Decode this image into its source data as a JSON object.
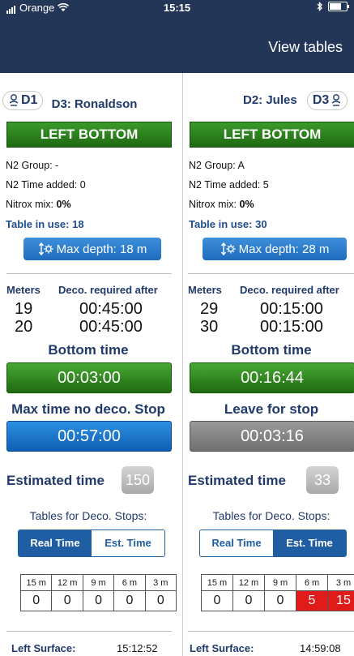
{
  "status_bar": {
    "carrier": "Orange",
    "time": "15:15"
  },
  "nav": {
    "title": "View tables"
  },
  "left": {
    "prev_label": "D1",
    "diver_name": "D3: Ronaldson",
    "state": "LEFT BOTTOM",
    "n2_group_label": "N2 Group:",
    "n2_group": "-",
    "n2_time_label": "N2 Time added:",
    "n2_time": "0",
    "nitrox_label": "Nitrox mix:",
    "nitrox": "0%",
    "table_in_use": "Table in use: 18",
    "max_depth": "Max depth: 18 m",
    "meters_header": "Meters",
    "deco_header": "Deco. required after",
    "deco_rows": [
      {
        "m": "19",
        "t": "00:45:00"
      },
      {
        "m": "20",
        "t": "00:45:00"
      }
    ],
    "bottom_time_label": "Bottom time",
    "bottom_time": "00:03:00",
    "timer2_label": "Max time no deco. Stop",
    "timer2": "00:57:00",
    "est_label": "Estimated time",
    "est_value": "150",
    "tables_label": "Tables for Deco. Stops:",
    "seg_real": "Real Time",
    "seg_est": "Est. Time",
    "stop_headers": [
      "15 m",
      "12 m",
      "9 m",
      "6 m",
      "3 m"
    ],
    "stops": [
      "0",
      "0",
      "0",
      "0",
      "0"
    ],
    "surface_label": "Left Surface:",
    "surface_time": "15:12:52"
  },
  "right": {
    "diver_name": "D2: Jules",
    "next_label": "D3",
    "state": "LEFT BOTTOM",
    "n2_group_label": "N2 Group:",
    "n2_group": "A",
    "n2_time_label": "N2 Time added:",
    "n2_time": "5",
    "nitrox_label": "Nitrox mix:",
    "nitrox": "0%",
    "table_in_use": "Table in use: 30",
    "max_depth": "Max depth: 28 m",
    "meters_header": "Meters",
    "deco_header": "Deco. required after",
    "deco_rows": [
      {
        "m": "29",
        "t": "00:15:00"
      },
      {
        "m": "30",
        "t": "00:15:00"
      }
    ],
    "bottom_time_label": "Bottom time",
    "bottom_time": "00:16:44",
    "timer2_label": "Leave for stop",
    "timer2": "00:03:16",
    "est_label": "Estimated time",
    "est_value": "33",
    "tables_label": "Tables for Deco. Stops:",
    "seg_real": "Real Time",
    "seg_est": "Est. Time",
    "stop_headers": [
      "15 m",
      "12 m",
      "9 m",
      "6 m",
      "3 m"
    ],
    "stops": [
      "0",
      "0",
      "0",
      "5",
      "15"
    ],
    "surface_label": "Left Surface:",
    "surface_time": "14:59:08"
  },
  "icons": {
    "diver": "diver-icon",
    "depth": "depth-icon",
    "signal": "signal-icon",
    "wifi": "wifi-icon",
    "bluetooth": "bluetooth-icon",
    "battery": "battery-icon"
  },
  "colors": {
    "nav": "#243657",
    "green": "#2e8a1f",
    "blue": "#1f6cbc",
    "red": "#e11a1a",
    "gray": "#8a8a8a"
  }
}
